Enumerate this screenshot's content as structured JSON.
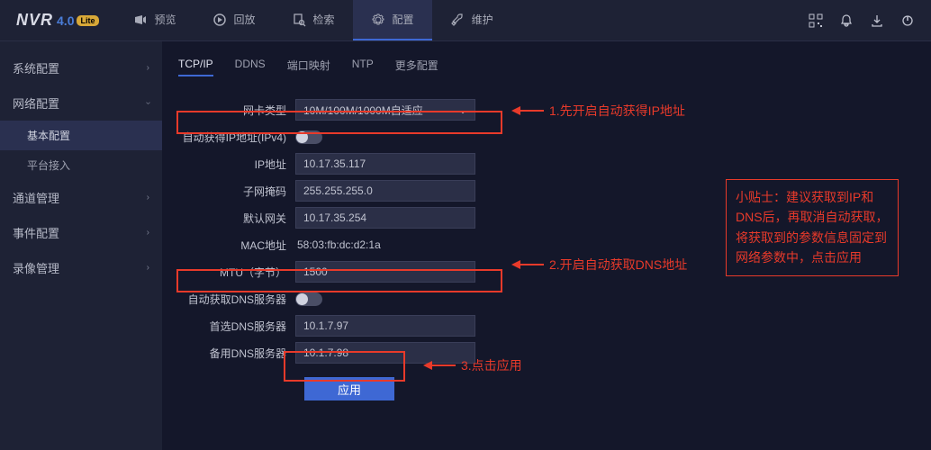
{
  "logo": {
    "name": "NVR",
    "version": "4.0",
    "badge": "Lite"
  },
  "mainTabs": {
    "preview": "预览",
    "playback": "回放",
    "search": "检索",
    "config": "配置",
    "maintain": "维护"
  },
  "sidebar": {
    "system": "系统配置",
    "network": "网络配置",
    "basic": "基本配置",
    "platform": "平台接入",
    "channel": "通道管理",
    "event": "事件配置",
    "record": "录像管理"
  },
  "subTabs": {
    "tcpip": "TCP/IP",
    "ddns": "DDNS",
    "port": "端口映射",
    "ntp": "NTP",
    "more": "更多配置"
  },
  "form": {
    "nicType": {
      "label": "网卡类型",
      "value": "10M/100M/1000M自适应"
    },
    "autoIP": {
      "label": "自动获得IP地址(IPv4)"
    },
    "ip": {
      "label": "IP地址",
      "value": "10.17.35.117"
    },
    "mask": {
      "label": "子网掩码",
      "value": "255.255.255.0"
    },
    "gateway": {
      "label": "默认网关",
      "value": "10.17.35.254"
    },
    "mac": {
      "label": "MAC地址",
      "value": "58:03:fb:dc:d2:1a"
    },
    "mtu": {
      "label": "MTU（字节）",
      "value": "1500"
    },
    "autoDNS": {
      "label": "自动获取DNS服务器"
    },
    "dns1": {
      "label": "首选DNS服务器",
      "value": "10.1.7.97"
    },
    "dns2": {
      "label": "备用DNS服务器",
      "value": "10.1.7.98"
    },
    "apply": "应用"
  },
  "annotations": {
    "a1": "1.先开启自动获得IP地址",
    "a2": "2.开启自动获取DNS地址",
    "a3": "3.点击应用",
    "tip": "小贴士：建议获取到IP和DNS后，再取消自动获取，将获取到的参数信息固定到网络参数中，点击应用"
  }
}
